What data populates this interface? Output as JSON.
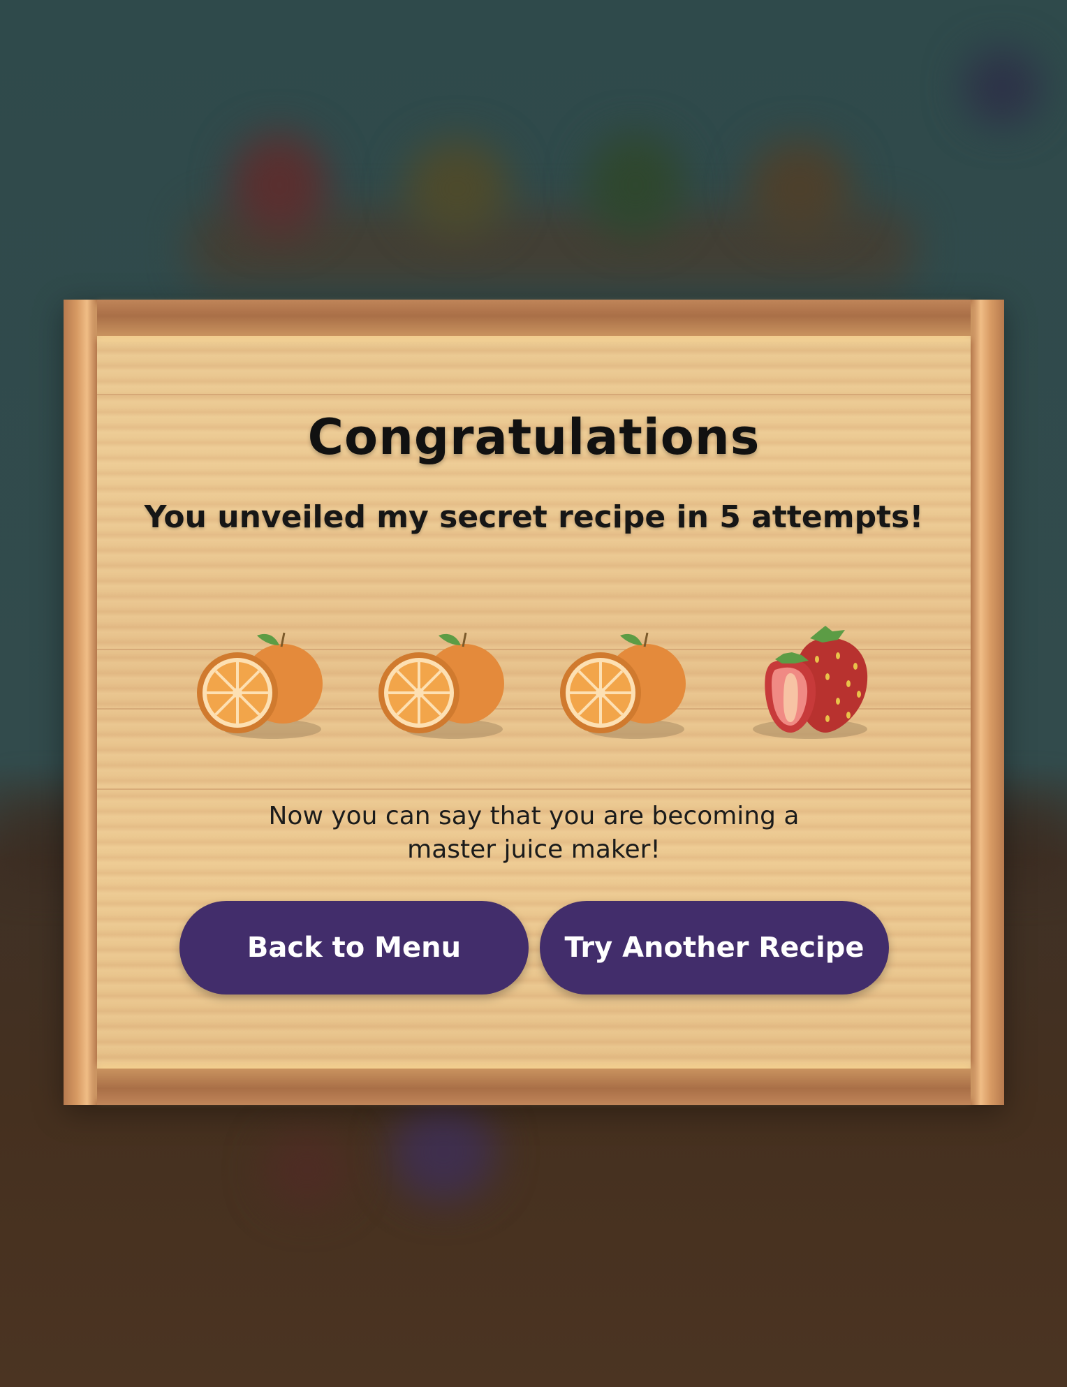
{
  "dialog": {
    "title": "Congratulations",
    "subtitle": "You unveiled my secret recipe in 5 attempts!",
    "message_line1": "Now you can say that you are becoming a",
    "message_line2": "master juice maker!"
  },
  "recipe": {
    "fruits": [
      {
        "icon": "orange-icon"
      },
      {
        "icon": "orange-icon"
      },
      {
        "icon": "orange-icon"
      },
      {
        "icon": "strawberry-icon"
      }
    ]
  },
  "buttons": {
    "back_to_menu": "Back to Menu",
    "try_another": "Try Another Recipe"
  },
  "colors": {
    "button_bg": "#422d6b",
    "button_text": "#ffffff",
    "wood_light": "#ecca93",
    "wood_frame": "#b77a4e"
  }
}
